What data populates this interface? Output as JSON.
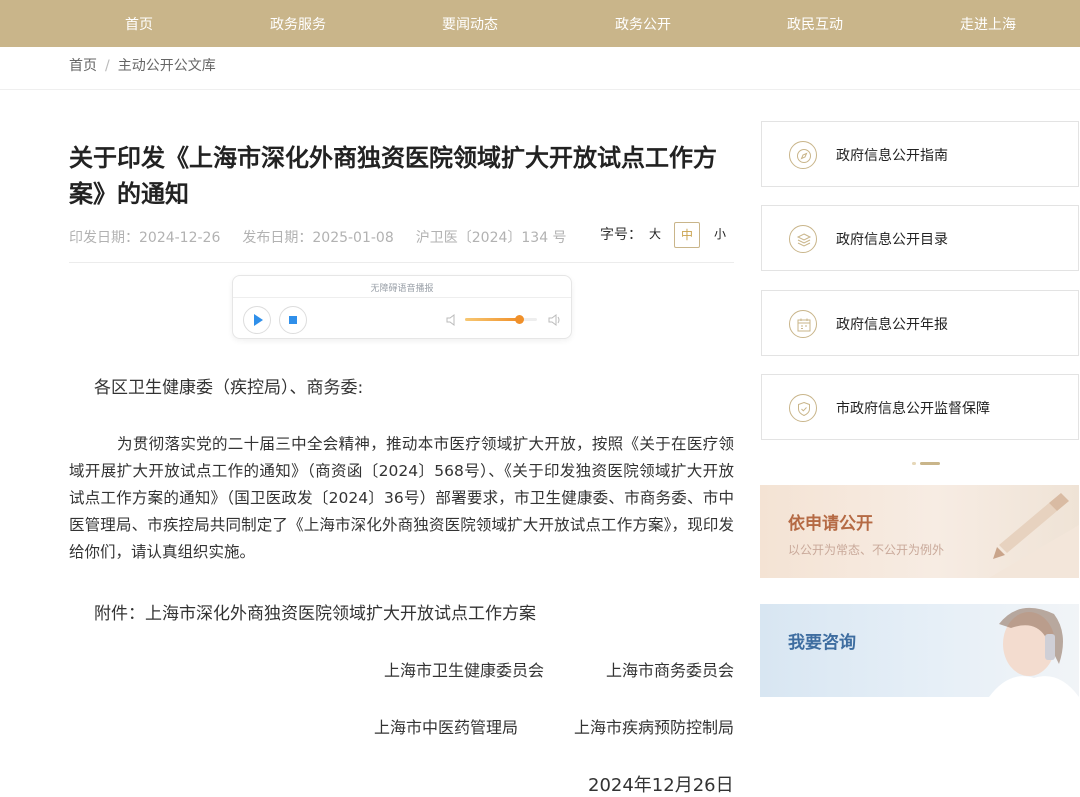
{
  "nav": [
    "首页",
    "政务服务",
    "要闻动态",
    "政务公开",
    "政民互动",
    "走进上海"
  ],
  "breadcrumb": [
    "首页",
    "主动公开公文库"
  ],
  "article": {
    "title": "关于印发《上海市深化外商独资医院领域扩大开放试点工作方案》的通知",
    "issue_date": "印发日期：2024-12-26",
    "publish_date": "发布日期：2025-01-08",
    "doc_number": "沪卫医〔2024〕134 号",
    "font_size_label": "字号：",
    "font_sizes": [
      "大",
      "中",
      "小"
    ],
    "font_size_active": "中",
    "salutation": "各区卫生健康委（疾控局）、商务委:",
    "paragraph": "为贯彻落实党的二十届三中全会精神，推动本市医疗领域扩大开放，按照《关于在医疗领域开展扩大开放试点工作的通知》（商资函〔2024〕568号）、《关于印发独资医院领域扩大开放试点工作方案的通知》（国卫医政发〔2024〕36号）部署要求，市卫生健康委、市商务委、市中医管理局、市疾控局共同制定了《上海市深化外商独资医院领域扩大开放试点工作方案》，现印发给你们，请认真组织实施。",
    "attachment": "附件：上海市深化外商独资医院领域扩大开放试点工作方案",
    "signatures": [
      "上海市卫生健康委员会",
      "上海市商务委员会",
      "上海市中医药管理局",
      "上海市疾病预防控制局"
    ],
    "date": "2024年12月26日"
  },
  "player": {
    "title": "无障碍语音播报",
    "volume": 0.75,
    "accent": "#f0902a"
  },
  "sidebar": {
    "links": [
      {
        "label": "政府信息公开指南",
        "icon": "compass-icon"
      },
      {
        "label": "政府信息公开目录",
        "icon": "layers-icon"
      },
      {
        "label": "政府信息公开年报",
        "icon": "calendar-icon"
      },
      {
        "label": "市政府信息公开监督保障",
        "icon": "shield-check-icon"
      }
    ],
    "banners": [
      {
        "title": "依申请公开",
        "subtitle": "以公开为常态、不公开为例外"
      },
      {
        "title": "我要咨询",
        "subtitle": ""
      }
    ]
  },
  "colors": {
    "brand": "#c9b58a",
    "accent_text": "#b56a44",
    "consult_text": "#3e6da0"
  }
}
